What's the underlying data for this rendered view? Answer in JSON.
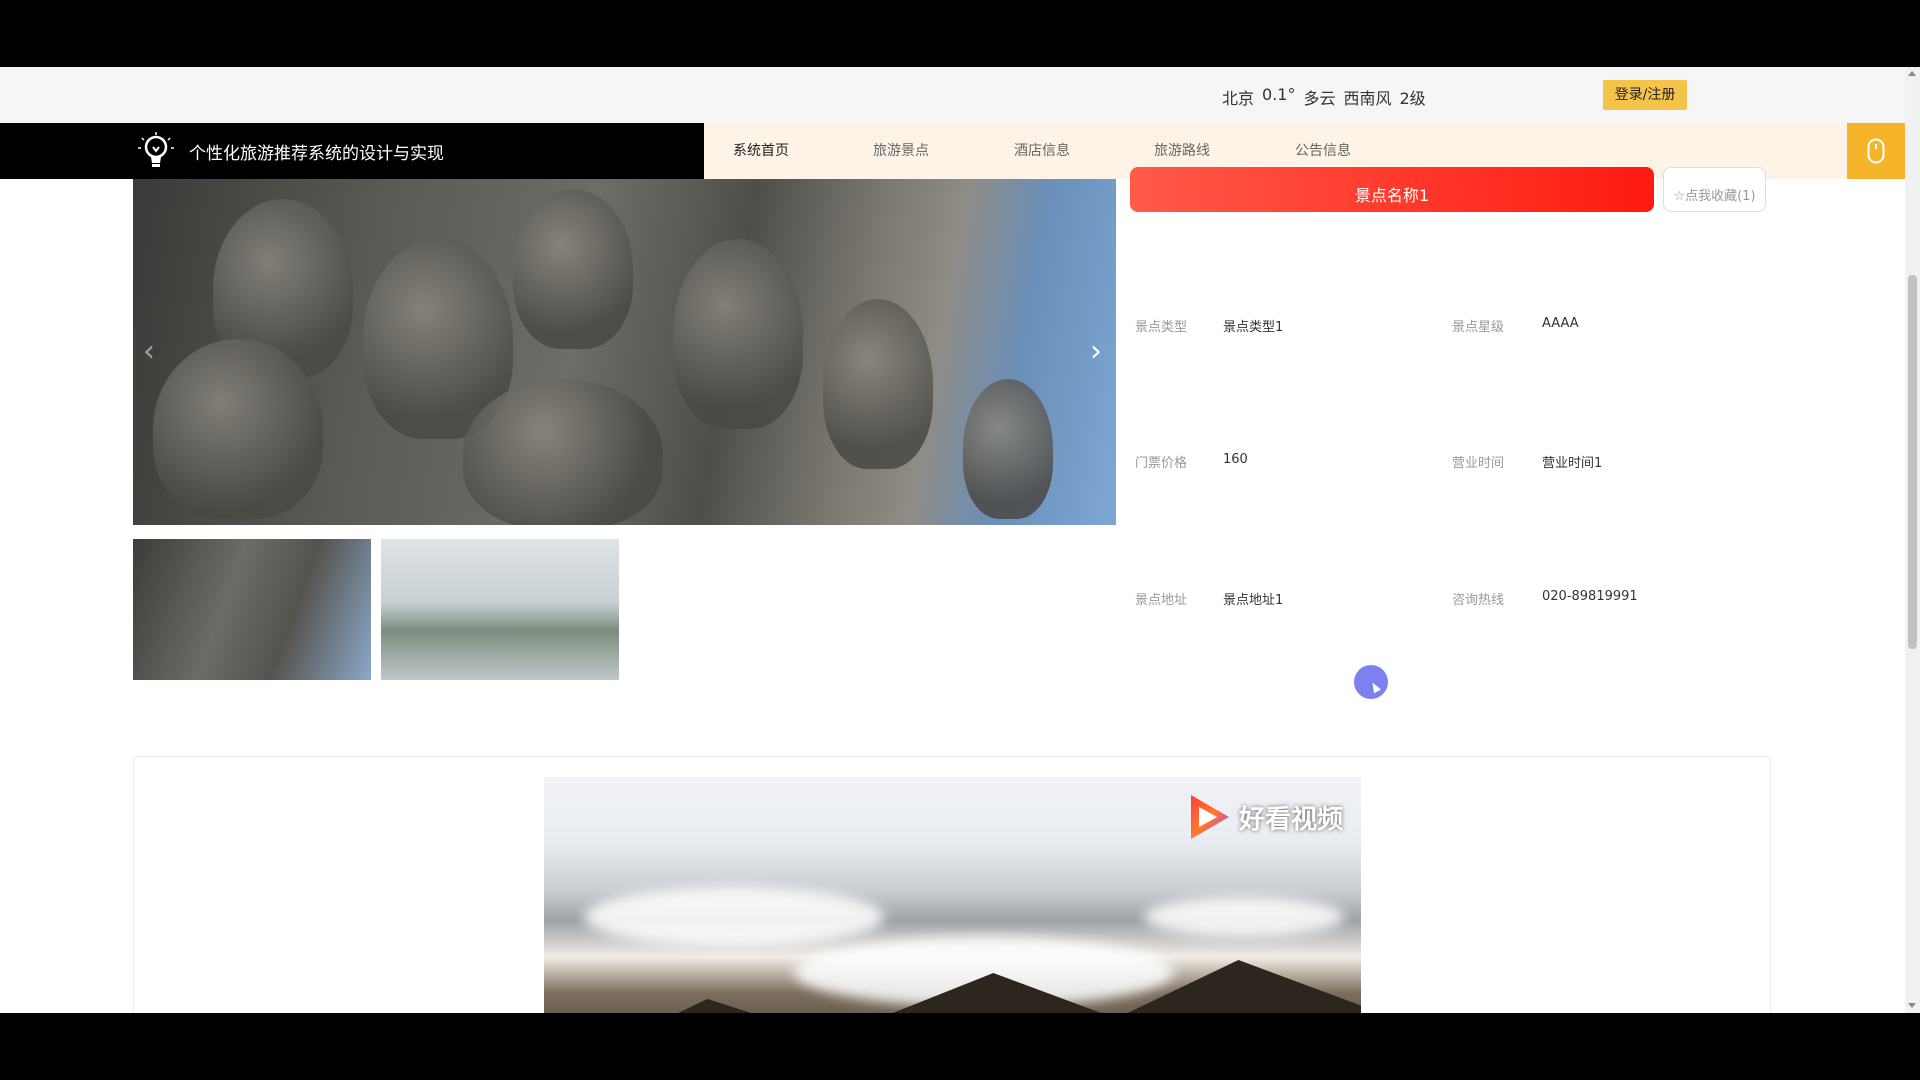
{
  "weather": {
    "city": "北京",
    "temp": "0.1°",
    "condition": "多云",
    "wind": "西南风",
    "level": "2级"
  },
  "header": {
    "login_label": "登录/注册",
    "site_title": "个性化旅游推荐系统的设计与实现"
  },
  "nav": {
    "items": [
      {
        "label": "系统首页"
      },
      {
        "label": "旅游景点"
      },
      {
        "label": "酒店信息"
      },
      {
        "label": "旅游路线"
      },
      {
        "label": "公告信息"
      }
    ]
  },
  "detail": {
    "name": "景点名称1",
    "collect_label": "☆点我收藏(1)",
    "fields": [
      {
        "label": "景点类型",
        "value": "景点类型1"
      },
      {
        "label": "景点星级",
        "value": "AAAA"
      },
      {
        "label": "门票价格",
        "value": "160"
      },
      {
        "label": "营业时间",
        "value": "营业时间1"
      },
      {
        "label": "景点地址",
        "value": "景点地址1"
      },
      {
        "label": "咨询热线",
        "value": "020-89819991"
      }
    ]
  },
  "video": {
    "logo_text": "好看视频"
  },
  "colors": {
    "accent": "#f5b42a",
    "name_bar": "#ff1a10",
    "nav_bg": "#fdf4e7",
    "brand_bg": "#000000"
  }
}
